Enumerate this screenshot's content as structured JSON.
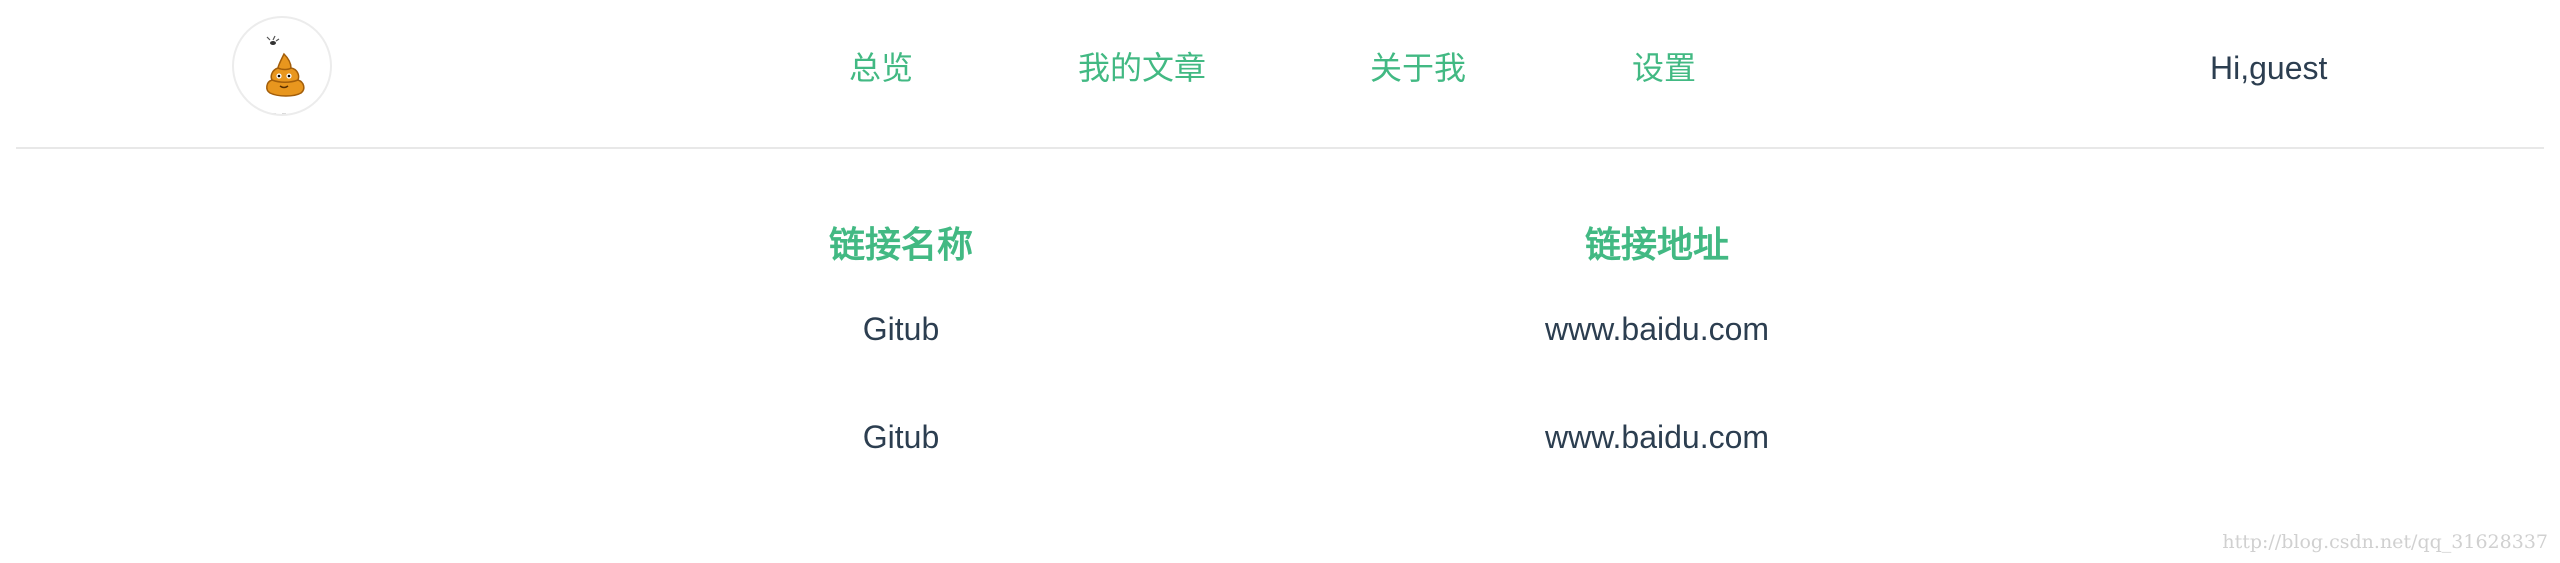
{
  "header": {
    "logo_alt": "logo",
    "nav": [
      {
        "label": "总览"
      },
      {
        "label": "我的文章"
      },
      {
        "label": "关于我"
      },
      {
        "label": "设置"
      }
    ],
    "greeting": "Hi,guest"
  },
  "links_table": {
    "headers": {
      "name": "链接名称",
      "url": "链接地址"
    },
    "rows": [
      {
        "name": "Gitub",
        "url": "www.baidu.com"
      },
      {
        "name": "Gitub",
        "url": "www.baidu.com"
      }
    ]
  },
  "watermark": "http://blog.csdn.net/qq_31628337",
  "colors": {
    "accent": "#42b983",
    "text": "#2c3e50",
    "divider": "#e8e8e8",
    "logo_body": "#e8961e"
  },
  "icons": {
    "logo": "cartoon-mascot-icon"
  }
}
